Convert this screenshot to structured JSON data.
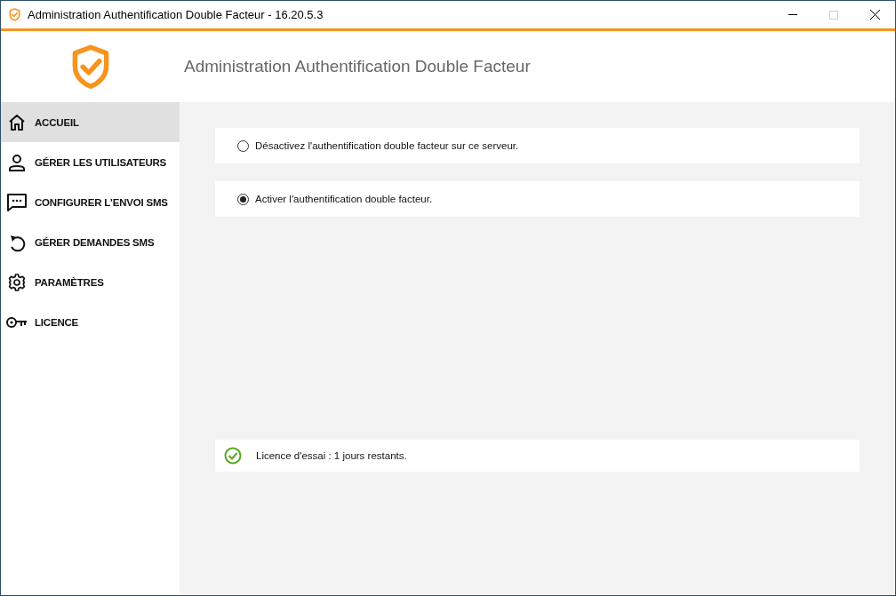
{
  "window": {
    "title": "Administration Authentification Double Facteur - 16.20.5.3"
  },
  "header": {
    "title": "Administration Authentification Double Facteur"
  },
  "sidebar": {
    "items": [
      {
        "label": "ACCUEIL",
        "selected": true
      },
      {
        "label": "GÉRER LES UTILISATEURS",
        "selected": false
      },
      {
        "label": "CONFIGURER L'ENVOI SMS",
        "selected": false
      },
      {
        "label": "GÉRER DEMANDES SMS",
        "selected": false
      },
      {
        "label": "PARAMÈTRES",
        "selected": false
      },
      {
        "label": "LICENCE",
        "selected": false
      }
    ]
  },
  "options": [
    {
      "label": "Désactivez l'authentification double facteur sur ce serveur.",
      "selected": false
    },
    {
      "label": "Activer l'authentification double facteur.",
      "selected": true
    }
  ],
  "status": {
    "text": "Licence d'essai : 1 jours restants."
  }
}
